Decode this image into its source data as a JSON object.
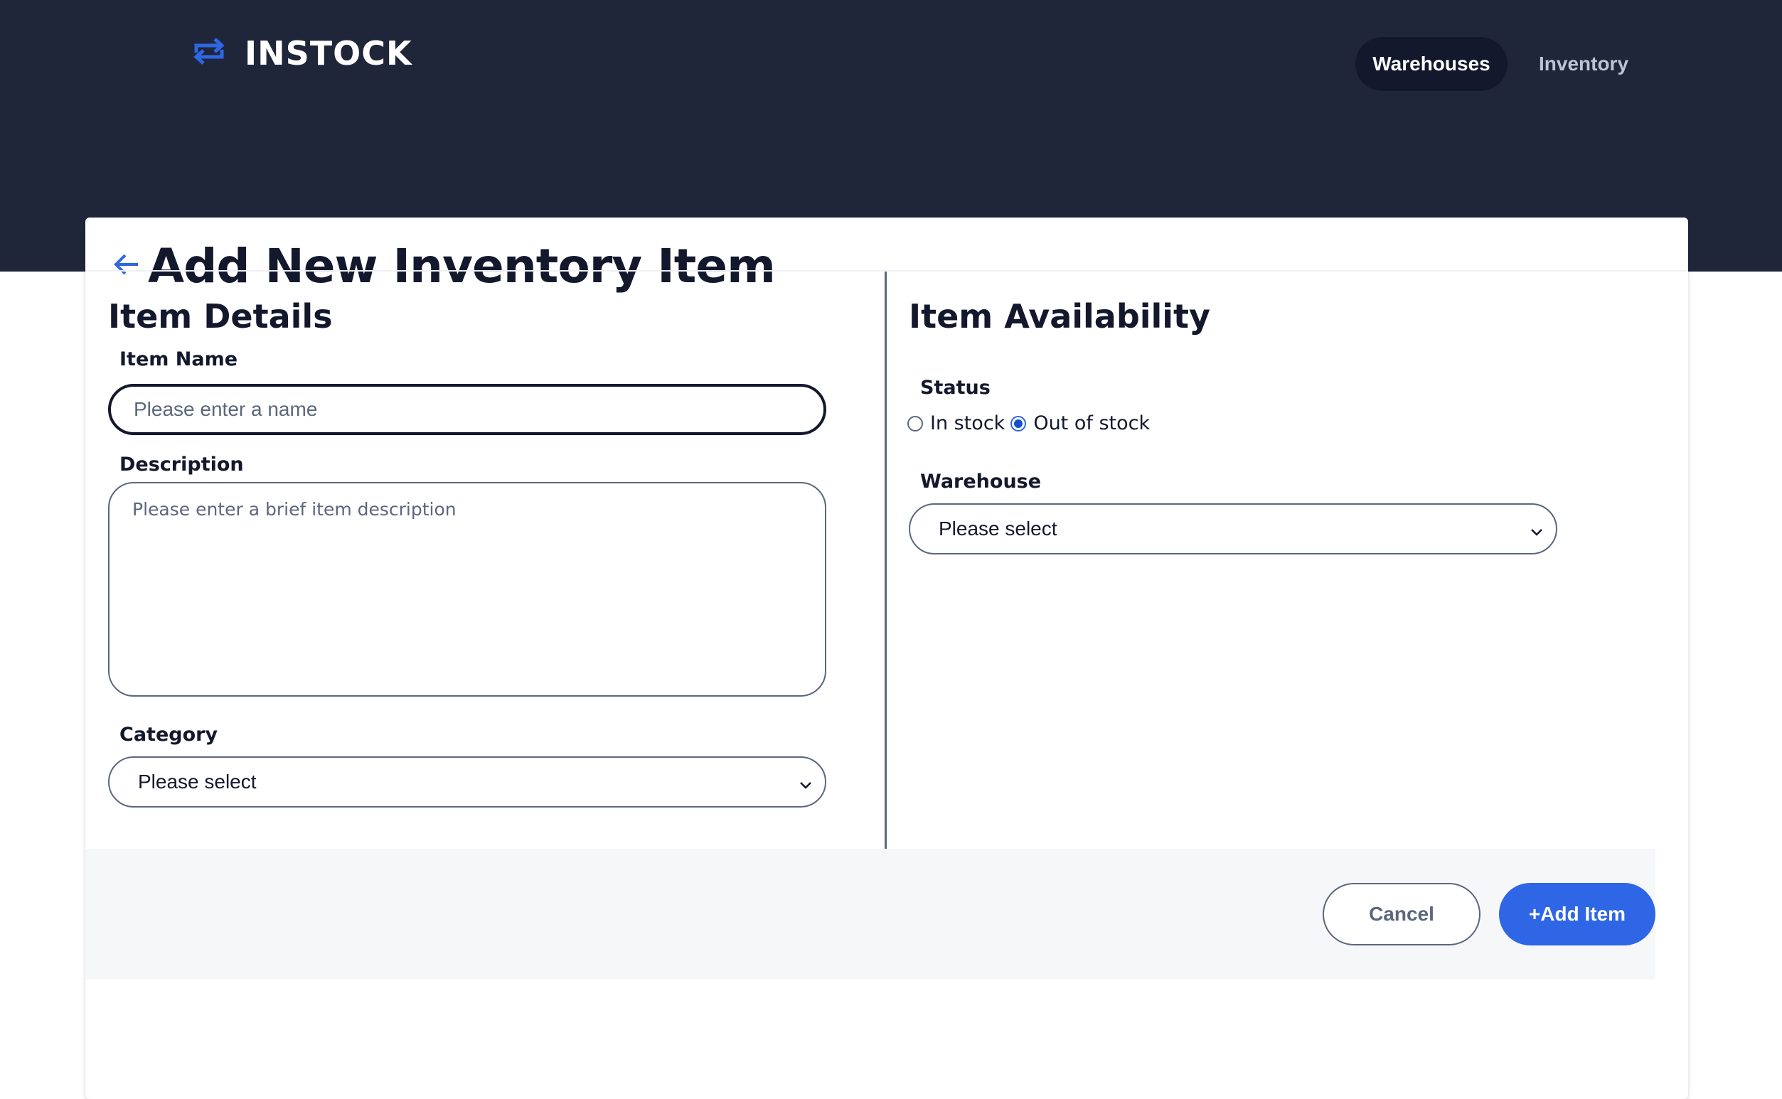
{
  "app": {
    "logo_text": "INSTOCK",
    "logo_icon": "swap-arrows-icon"
  },
  "nav": {
    "items": [
      {
        "label": "Warehouses",
        "active": true
      },
      {
        "label": "Inventory",
        "active": false
      }
    ]
  },
  "page": {
    "title": "Add New Inventory Item",
    "back_icon": "arrow-left-icon"
  },
  "item_details": {
    "section_title": "Item Details",
    "name_label": "Item Name",
    "name_placeholder": "Please enter a name",
    "description_label": "Description",
    "description_placeholder": "Please enter a brief item description",
    "category_label": "Category",
    "category_value": "Please select"
  },
  "item_availability": {
    "section_title": "Item Availability",
    "status_label": "Status",
    "status_options": [
      {
        "label": "In stock",
        "checked": false
      },
      {
        "label": "Out of stock",
        "checked": true
      }
    ],
    "warehouse_label": "Warehouse",
    "warehouse_value": "Please select"
  },
  "actions": {
    "cancel_label": "Cancel",
    "add_label": "+Add Item"
  },
  "colors": {
    "header_bg": "#202639",
    "nav_active_bg": "#13182c",
    "primary": "#2e66e5",
    "text_dark": "#13182c",
    "border": "#5c667e",
    "footer_bg": "#f6f7f9"
  }
}
